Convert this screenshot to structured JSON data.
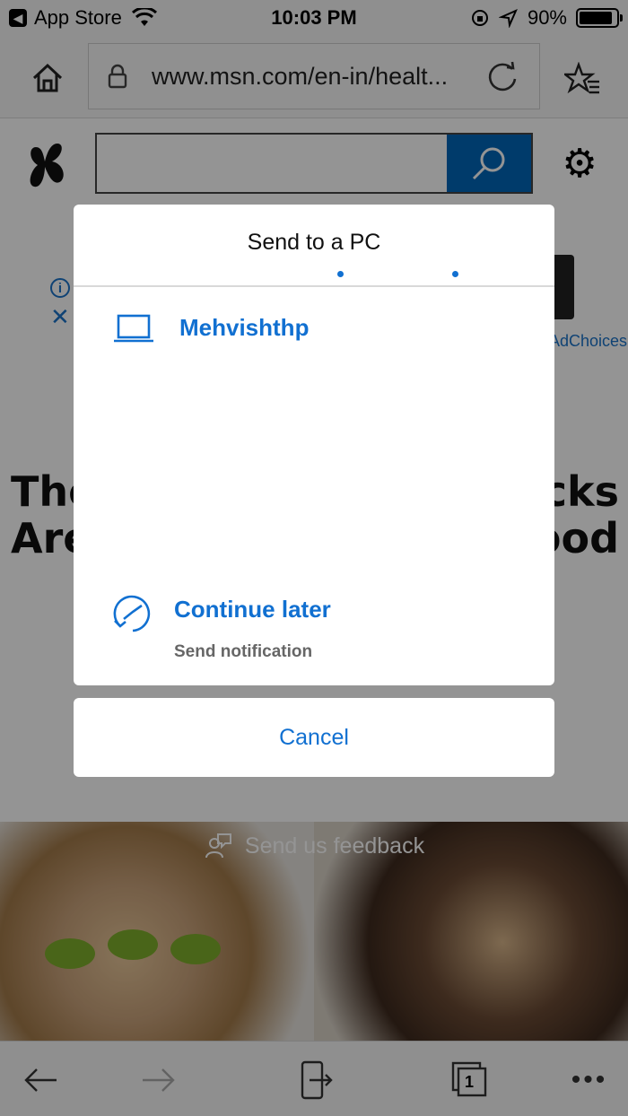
{
  "status_bar": {
    "back_app": "App Store",
    "time": "10:03 PM",
    "battery": "90%",
    "battery_level": 0.9
  },
  "browser": {
    "url": "www.msn.com/en-in/healt..."
  },
  "page": {
    "headline_left_1": "The",
    "headline_right_1": "cks",
    "headline_left_2": "Are",
    "headline_right_2": "ood",
    "ad_choices": "AdChoices",
    "feedback": "Send us feedback"
  },
  "sheet": {
    "title": "Send to a PC",
    "device_name": "Mehvishthp",
    "continue_later": "Continue later",
    "continue_later_sub": "Send notification",
    "cancel": "Cancel"
  },
  "bottom_bar": {
    "tab_count": "1"
  },
  "colors": {
    "accent": "#1170d1",
    "msn_blue": "#0067b8"
  }
}
